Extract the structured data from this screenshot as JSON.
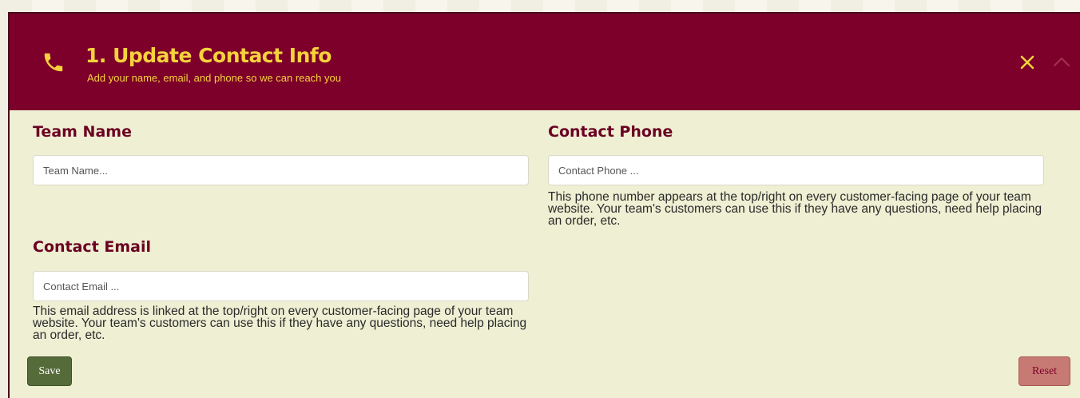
{
  "header": {
    "title": "1. Update Contact Info",
    "subtitle": "Add your name, email, and phone so we can reach you",
    "icon": "phone-icon",
    "close_icon": "close-icon",
    "collapse_icon": "chevron-up-icon"
  },
  "form": {
    "team_name": {
      "label": "Team Name",
      "placeholder": "Team Name...",
      "value": ""
    },
    "contact_phone": {
      "label": "Contact Phone",
      "placeholder": "Contact Phone ...",
      "value": "",
      "help": "This phone number appears at the top/right on every customer-facing page of your team website. Your team's customers can use this if they have any questions, need help placing an order, etc."
    },
    "contact_email": {
      "label": "Contact Email",
      "placeholder": "Contact Email ...",
      "value": "",
      "help": "This email address is linked at the top/right on every customer-facing page of your team website. Your team's customers can use this if they have any questions, need help placing an order, etc."
    }
  },
  "actions": {
    "save_label": "Save",
    "reset_label": "Reset"
  },
  "colors": {
    "header_bg": "#7d002a",
    "accent_yellow": "#f5d23c",
    "panel_bg": "#eeefd3",
    "label_color": "#6b0022",
    "save_bg": "#556b3a",
    "reset_bg": "#c77a74"
  }
}
